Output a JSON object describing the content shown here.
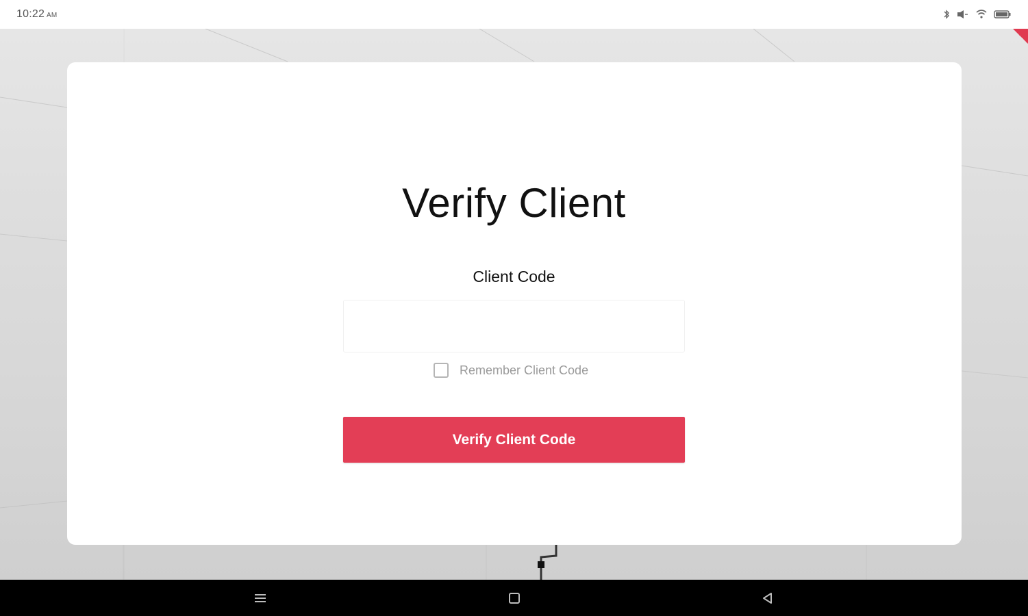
{
  "status_bar": {
    "time": "10:22",
    "ampm": "AM",
    "icons": [
      "bluetooth-icon",
      "vibrate-icon",
      "wifi-icon",
      "battery-icon"
    ]
  },
  "card": {
    "title": "Verify Client",
    "field_label": "Client Code",
    "input_value": "",
    "remember_label": "Remember Client Code",
    "remember_checked": false,
    "button_label": "Verify Client Code"
  },
  "nav_bar": {
    "icons": [
      "menu-icon",
      "home-icon",
      "back-icon"
    ]
  },
  "colors": {
    "accent": "#e33e56",
    "card": "#ffffff",
    "nav": "#000000"
  }
}
